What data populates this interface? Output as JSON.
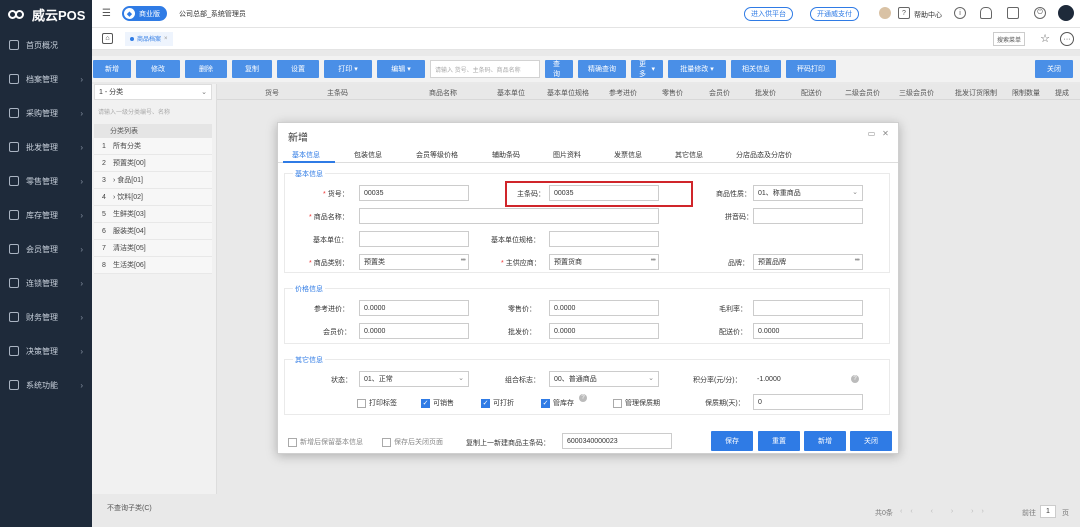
{
  "app": {
    "logo_text": "威云POS",
    "edition": "商业版",
    "org_user": "公司总部_系统管理员"
  },
  "topbar": {
    "pill_supply": "进入供平台",
    "pill_pay": "开通威支付",
    "help_center": "帮助中心"
  },
  "sidebar": {
    "items": [
      {
        "label": "首页概况",
        "icon": "home-icon"
      },
      {
        "label": "档案管理",
        "icon": "archive-icon"
      },
      {
        "label": "采购管理",
        "icon": "cart-icon"
      },
      {
        "label": "批发管理",
        "icon": "wholesale-icon"
      },
      {
        "label": "零售管理",
        "icon": "retail-icon"
      },
      {
        "label": "库存管理",
        "icon": "inventory-icon"
      },
      {
        "label": "会员管理",
        "icon": "member-icon"
      },
      {
        "label": "连锁管理",
        "icon": "chain-icon"
      },
      {
        "label": "财务管理",
        "icon": "finance-icon"
      },
      {
        "label": "决策管理",
        "icon": "decision-icon"
      },
      {
        "label": "系统功能",
        "icon": "system-icon"
      }
    ]
  },
  "tabs": {
    "page_tab": "商品档案",
    "menu_search": "搜索菜单"
  },
  "toolbar": {
    "buttons": [
      "新增",
      "修改",
      "删除",
      "复制",
      "设置",
      "打印",
      "编辑"
    ],
    "search_placeholder": "请输入 货号、主条码、商品名称",
    "buttons2": [
      "查询",
      "精确查询",
      "更多",
      "批量修改",
      "相关信息",
      "秤码打印"
    ],
    "close": "关闭"
  },
  "left": {
    "category_select": "1 - 分类",
    "category_search": "请输入一级分类编号、名称",
    "list_header": "分类列表",
    "items": [
      {
        "num": "1",
        "label": "所有分类"
      },
      {
        "num": "2",
        "label": "预置类[00]"
      },
      {
        "num": "3",
        "label": "› 食品[01]"
      },
      {
        "num": "4",
        "label": "› 饮料[02]"
      },
      {
        "num": "5",
        "label": "生鲜类[03]"
      },
      {
        "num": "6",
        "label": "服装类[04]"
      },
      {
        "num": "7",
        "label": "清洁类[05]"
      },
      {
        "num": "8",
        "label": "生活类[06]"
      }
    ],
    "footer": "不查询子类(C)"
  },
  "grid": {
    "headers": [
      "货号",
      "主条码",
      "商品名称",
      "基本单位",
      "基本单位规格",
      "参考进价",
      "零售价",
      "会员价",
      "批发价",
      "配送价",
      "二级会员价",
      "三级会员价",
      "批发订货限制",
      "限制数量",
      "提成"
    ]
  },
  "pager": {
    "total": "共0条",
    "page_label": "前往",
    "page": "1",
    "page_unit": "页"
  },
  "dialog": {
    "title": "新增",
    "tabs": [
      "基本信息",
      "包装信息",
      "会员等级价格",
      "辅助条码",
      "图片资料",
      "发票信息",
      "其它信息",
      "分店品态及分店价"
    ],
    "basic": {
      "title": "基本信息",
      "item_no_label": "货号：",
      "item_no": "00035",
      "barcode_label": "主条码：",
      "barcode": "00035",
      "nature_label": "商品性质：",
      "nature": "01、称重商品",
      "name_label": "商品名称：",
      "name": "",
      "pinyin_label": "拼音码：",
      "pinyin": "",
      "unit_label": "基本单位：",
      "unit": "",
      "spec_label": "基本单位规格：",
      "spec": "",
      "category_label": "商品类别：",
      "category": "预置类",
      "supplier_label": "主供应商：",
      "supplier": "预置货商",
      "brand_label": "品牌：",
      "brand": "预置品牌"
    },
    "price": {
      "title": "价格信息",
      "cost_label": "参考进价：",
      "cost": "0.0000",
      "retail_label": "零售价：",
      "retail": "0.0000",
      "margin_label": "毛利率：",
      "margin": "",
      "member_label": "会员价：",
      "member": "0.0000",
      "wholesale_label": "批发价：",
      "wholesale": "0.0000",
      "delivery_label": "配送价：",
      "delivery": "0.0000"
    },
    "other": {
      "title": "其它信息",
      "status_label": "状态：",
      "status": "01、正常",
      "combo_label": "组合标志：",
      "combo": "00、普通商品",
      "points_label": "积分率(元/分)：",
      "points": "-1.0000",
      "cb_print_label": "打印标签",
      "cb_sell": "可销售",
      "cb_discount": "可打折",
      "cb_stock": "管库存",
      "cb_shelf": "管理保质期",
      "shelf_life_label": "保质期(天)：",
      "shelf_life": "0"
    },
    "footer": {
      "keep_basic": "新增后保留基本信息",
      "close_after_save": "保存后关闭页面",
      "copy_label": "复制上一新建商品主条码：",
      "copy_value": "6000340000023",
      "save": "保存",
      "reset": "重置",
      "add": "新增",
      "close": "关闭"
    }
  }
}
